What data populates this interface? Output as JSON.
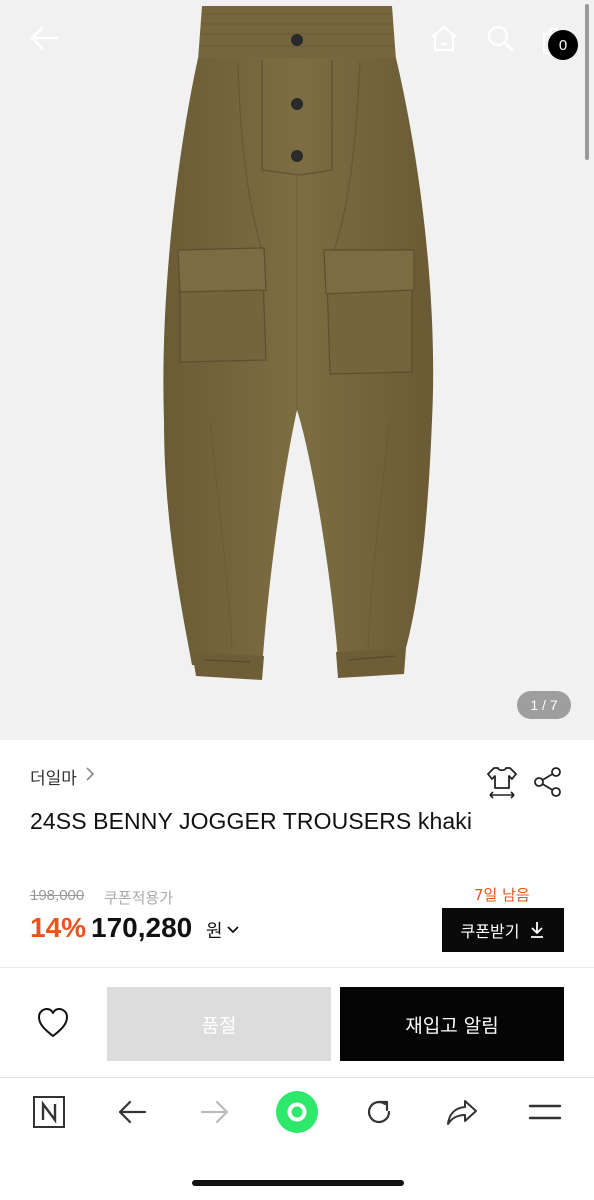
{
  "header": {
    "cart_count": "0",
    "icons": [
      "back-arrow-icon",
      "home-icon",
      "search-icon",
      "shopping-bag-icon"
    ]
  },
  "gallery": {
    "current": "1",
    "total": "7",
    "indicator": "1 / 7"
  },
  "product": {
    "brand": "더일마",
    "title": "24SS BENNY JOGGER TROUSERS khaki",
    "original_price": "198,000",
    "coupon_note": "쿠폰적용가",
    "time_left": "7일 남음",
    "discount": "14%",
    "price": "170,280",
    "price_unit": "원",
    "coupon_button": "쿠폰받기"
  },
  "actions": {
    "soldout_label": "품절",
    "restock_label": "재입고 알림"
  },
  "browser_toolbar": {
    "icons": [
      "naver-n-icon",
      "back-arrow-icon",
      "forward-arrow-icon",
      "green-dot-icon",
      "refresh-icon",
      "share-arrow-icon",
      "menu-icon"
    ]
  },
  "colors": {
    "accent": "#e8541e",
    "product_khaki": "#7a6a3f",
    "naver_green": "#2ee86b"
  }
}
